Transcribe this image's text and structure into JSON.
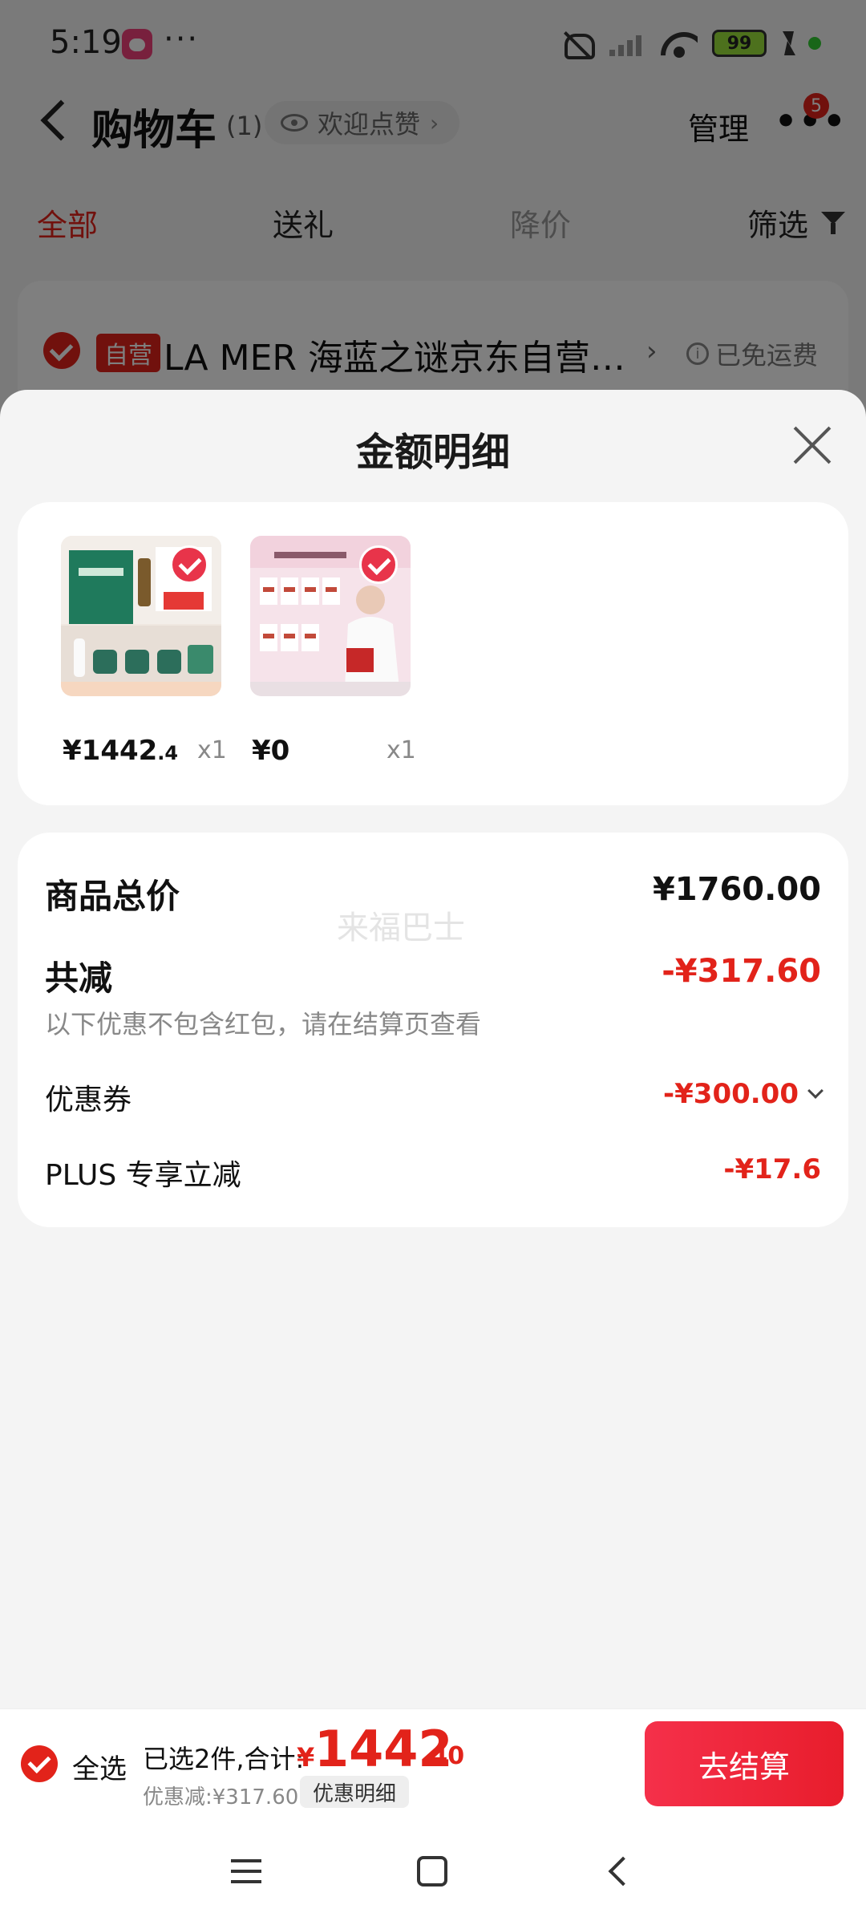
{
  "status_bar": {
    "time": "5:19",
    "more": "···",
    "battery": "99"
  },
  "cart_header": {
    "title": "购物车",
    "count": "(1)",
    "like_chip": "欢迎点赞",
    "manage": "管理",
    "menu_badge": "5"
  },
  "tabs": [
    {
      "label": "全部",
      "active": true
    },
    {
      "label": "送礼",
      "active": false
    },
    {
      "label": "降价",
      "active": false
    },
    {
      "label": "筛选",
      "active": false
    }
  ],
  "shop": {
    "tag": "自营",
    "name": "LA MER 海蓝之谜京东自营…",
    "shipping": "已免运费"
  },
  "sheet": {
    "title": "金额明细",
    "products": [
      {
        "price_main": "¥1442",
        "price_decimal": ".4",
        "qty": "x1"
      },
      {
        "price_main": "¥0",
        "price_decimal": "",
        "qty": "x1"
      }
    ],
    "summary": {
      "total_label": "商品总价",
      "total_value": "¥1760.00",
      "reduce_label": "共减",
      "reduce_value": "-¥317.60",
      "note": "以下优惠不包含红包，请在结算页查看",
      "coupon_label": "优惠券",
      "coupon_value": "-¥300.00",
      "plus_label": "PLUS 专享立减",
      "plus_value": "-¥17.6",
      "watermark": "来福巴士"
    }
  },
  "bottom_bar": {
    "select_all": "全选",
    "selected": "已选2件,合计:",
    "total_yen": "¥",
    "total_int": "1442",
    "total_dec": ".40",
    "discount": "优惠减:¥317.60",
    "detail": "优惠明细",
    "checkout": "去结算"
  },
  "colors": {
    "accent": "#e2231a",
    "sheet_bg": "#f4f4f4"
  }
}
